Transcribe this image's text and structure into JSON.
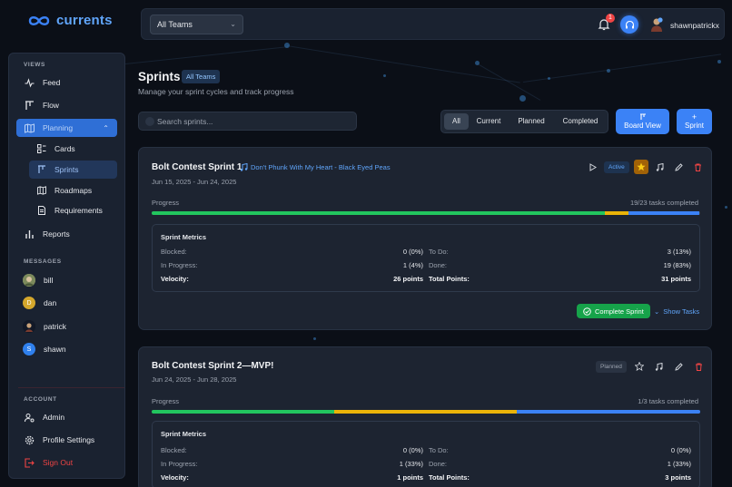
{
  "app": {
    "name": "currents"
  },
  "header": {
    "team_select": "All Teams",
    "notification_count": "1",
    "username": "shawnpatrickx"
  },
  "sidebar": {
    "views_label": "VIEWS",
    "feed": "Feed",
    "flow": "Flow",
    "planning": "Planning",
    "cards": "Cards",
    "sprints": "Sprints",
    "roadmaps": "Roadmaps",
    "requirements": "Requirements",
    "reports": "Reports",
    "messages_label": "MESSAGES",
    "messages": [
      {
        "name": "bill",
        "initial": "",
        "color": "#8a9a6a"
      },
      {
        "name": "dan",
        "initial": "D",
        "color": "#d4a72c"
      },
      {
        "name": "patrick",
        "initial": "",
        "color": "#1f2937"
      },
      {
        "name": "shawn",
        "initial": "S",
        "color": "#2f80ed"
      }
    ],
    "account_label": "ACCOUNT",
    "admin": "Admin",
    "profile_settings": "Profile Settings",
    "sign_out": "Sign Out"
  },
  "main": {
    "title": "Sprints",
    "team_pill": "All Teams",
    "subtitle": "Manage your sprint cycles and track progress",
    "search_placeholder": "Search sprints...",
    "filters": [
      "All",
      "Current",
      "Planned",
      "Completed"
    ],
    "active_filter": "All",
    "board_view": "Board View",
    "new_sprint": "Sprint",
    "new_sprint_icon": "+"
  },
  "sprints": [
    {
      "title": "Bolt Contest Sprint 1",
      "song": "Don't Phunk With My Heart - Black Eyed Peas",
      "dates": "Jun 15, 2025 - Jun 24, 2025",
      "status": "Active",
      "progress_label": "Progress",
      "progress_text": "19/23 tasks completed",
      "progress": {
        "done": 0.826,
        "in_progress": 0.043,
        "todo": 0.13
      },
      "metrics_title": "Sprint Metrics",
      "blocked_label": "Blocked:",
      "blocked": "0 (0%)",
      "in_progress_label": "In Progress:",
      "in_progress": "1 (4%)",
      "velocity_label": "Velocity:",
      "velocity": "26 points",
      "todo_label": "To Do:",
      "todo": "3 (13%)",
      "done_label": "Done:",
      "done": "19 (83%)",
      "total_label": "Total Points:",
      "total": "31 points",
      "complete_label": "Complete Sprint",
      "show_tasks_label": "Show Tasks"
    },
    {
      "title": "Bolt Contest Sprint 2—MVP!",
      "dates": "Jun 24, 2025 - Jun 28, 2025",
      "status": "Planned",
      "progress_label": "Progress",
      "progress_text": "1/3 tasks completed",
      "progress": {
        "done": 0.333,
        "in_progress": 0.333,
        "todo": 0.334
      },
      "metrics_title": "Sprint Metrics",
      "blocked_label": "Blocked:",
      "blocked": "0 (0%)",
      "in_progress_label": "In Progress:",
      "in_progress": "1 (33%)",
      "velocity_label": "Velocity:",
      "velocity": "1 points",
      "todo_label": "To Do:",
      "todo": "0 (0%)",
      "done_label": "Done:",
      "done": "1 (33%)",
      "total_label": "Total Points:",
      "total": "3 points"
    }
  ],
  "colors": {
    "accent": "#3b82f6",
    "done": "#22c55e",
    "in_progress": "#eab308",
    "todo": "#3b82f6",
    "danger": "#ef4444"
  }
}
